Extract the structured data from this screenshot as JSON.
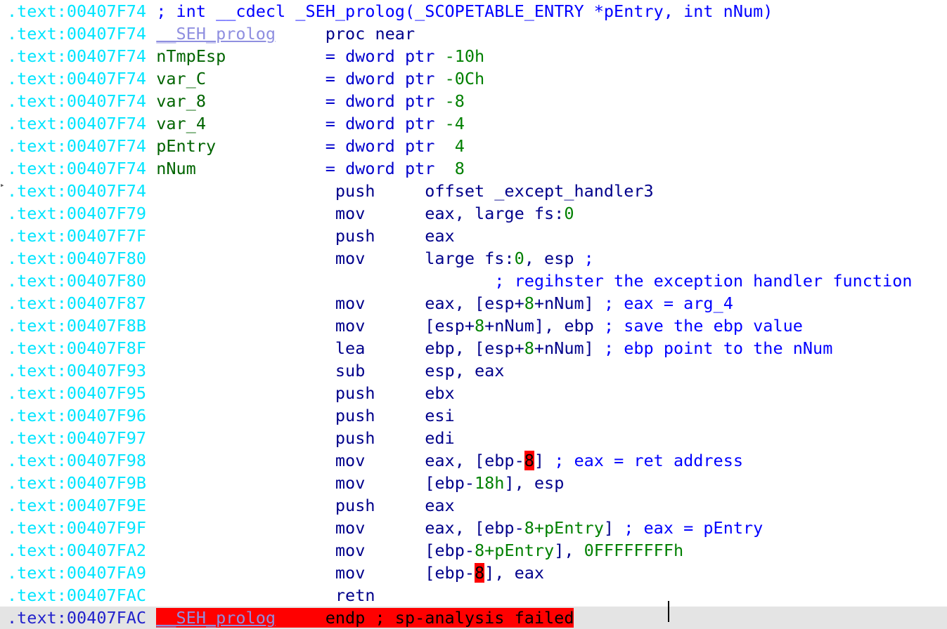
{
  "view": {
    "name": "IDA View-A",
    "segment": "text",
    "caret_visible": true
  },
  "colors": {
    "address": "#00e5ff",
    "address_current": "#2222cc",
    "keyword": "#00008b",
    "directive": "#0000cd",
    "local_var": "#006400",
    "number": "#008000",
    "comment": "#0000ff",
    "function_name": "#8f8fe0",
    "highlight_bg": "#ff0000",
    "highlight_fg": "#000000",
    "current_line_bg": "#e4e4e4",
    "background": "#ffffff"
  },
  "prototype": {
    "address": ".text:00407F74",
    "text": "; int __cdecl _SEH_prolog(_SCOPETABLE_ENTRY *pEntry, int nNum)"
  },
  "proc_header": {
    "address": ".text:00407F74",
    "name": "__SEH_prolog",
    "directive": "proc near"
  },
  "stack_vars": [
    {
      "address": ".text:00407F74",
      "name": "nTmpEsp",
      "eq": "=",
      "type": "dword ptr",
      "offset": "-10h"
    },
    {
      "address": ".text:00407F74",
      "name": "var_C",
      "eq": "=",
      "type": "dword ptr",
      "offset": "-0Ch"
    },
    {
      "address": ".text:00407F74",
      "name": "var_8",
      "eq": "=",
      "type": "dword ptr",
      "offset": "-8"
    },
    {
      "address": ".text:00407F74",
      "name": "var_4",
      "eq": "=",
      "type": "dword ptr",
      "offset": "-4"
    },
    {
      "address": ".text:00407F74",
      "name": "pEntry",
      "eq": "=",
      "type": "dword ptr",
      "offset": " 4"
    },
    {
      "address": ".text:00407F74",
      "name": "nNum",
      "eq": "=",
      "type": "dword ptr",
      "offset": " 8"
    }
  ],
  "instructions": [
    {
      "address": ".text:00407F74",
      "marker": "arrow",
      "mnemonic": "push",
      "op_pre": "offset _except_handler3",
      "op_num": "",
      "op_post": "",
      "comment": ""
    },
    {
      "address": ".text:00407F79",
      "marker": "",
      "mnemonic": "mov",
      "op_pre": "eax, large fs:",
      "op_num": "0",
      "op_post": "",
      "comment": ""
    },
    {
      "address": ".text:00407F7F",
      "marker": "",
      "mnemonic": "push",
      "op_pre": "eax",
      "op_num": "",
      "op_post": "",
      "comment": ""
    },
    {
      "address": ".text:00407F80",
      "marker": "",
      "mnemonic": "mov",
      "op_pre": "large fs:",
      "op_num": "0",
      "op_post": ", esp ",
      "comment": ";"
    },
    {
      "address": ".text:00407F80",
      "marker": "",
      "mnemonic": "",
      "op_pre": "",
      "op_num": "",
      "op_post": "",
      "comment": "; regihster the exception handler function",
      "comment_indent": true
    },
    {
      "address": ".text:00407F87",
      "marker": "",
      "mnemonic": "mov",
      "op_pre": "eax, [esp+",
      "op_num": "8",
      "op_post": "+nNum] ",
      "op_post_var": "nNum",
      "comment": "; eax = arg_4"
    },
    {
      "address": ".text:00407F8B",
      "marker": "",
      "mnemonic": "mov",
      "op_pre": "[esp+",
      "op_num": "8",
      "op_post": "+nNum], ebp ",
      "comment": "; save the ebp value"
    },
    {
      "address": ".text:00407F8F",
      "marker": "",
      "mnemonic": "lea",
      "op_pre": "ebp, [esp+",
      "op_num": "8",
      "op_post": "+nNum] ",
      "comment": "; ebp point to the nNum"
    },
    {
      "address": ".text:00407F93",
      "marker": "",
      "mnemonic": "sub",
      "op_pre": "esp, eax",
      "op_num": "",
      "op_post": "",
      "comment": ""
    },
    {
      "address": ".text:00407F95",
      "marker": "",
      "mnemonic": "push",
      "op_pre": "ebx",
      "op_num": "",
      "op_post": "",
      "comment": ""
    },
    {
      "address": ".text:00407F96",
      "marker": "",
      "mnemonic": "push",
      "op_pre": "esi",
      "op_num": "",
      "op_post": "",
      "comment": ""
    },
    {
      "address": ".text:00407F97",
      "marker": "",
      "mnemonic": "push",
      "op_pre": "edi",
      "op_num": "",
      "op_post": "",
      "comment": ""
    },
    {
      "address": ".text:00407F98",
      "marker": "",
      "mnemonic": "mov",
      "op_pre": "eax, [ebp-",
      "op_num": "8",
      "op_num_highlight": true,
      "op_post": "] ",
      "comment": "; eax = ret address"
    },
    {
      "address": ".text:00407F9B",
      "marker": "",
      "mnemonic": "mov",
      "op_pre": "[ebp-",
      "op_num": "18h",
      "op_post": "], esp",
      "comment": ""
    },
    {
      "address": ".text:00407F9E",
      "marker": "",
      "mnemonic": "push",
      "op_pre": "eax",
      "op_num": "",
      "op_post": "",
      "comment": ""
    },
    {
      "address": ".text:00407F9F",
      "marker": "",
      "mnemonic": "mov",
      "op_pre": "eax, [ebp-",
      "op_num": "8+pEntry",
      "op_post": "] ",
      "comment": "; eax = pEntry"
    },
    {
      "address": ".text:00407FA2",
      "marker": "",
      "mnemonic": "mov",
      "op_pre": "[ebp-",
      "op_num": "8+pEntry",
      "op_post": "], ",
      "op_tail_num": "0FFFFFFFFh",
      "comment": ""
    },
    {
      "address": ".text:00407FA9",
      "marker": "",
      "mnemonic": "mov",
      "op_pre": "[ebp-",
      "op_num": "8",
      "op_num_highlight": true,
      "op_post": "], eax",
      "comment": ""
    },
    {
      "address": ".text:00407FAC",
      "marker": "",
      "mnemonic": "retn",
      "op_pre": "",
      "op_num": "",
      "op_post": "",
      "comment": ""
    }
  ],
  "proc_footer": {
    "address": ".text:00407FAC",
    "name": "__SEH_prolog",
    "directive": "endp ; sp-analysis failed",
    "selected": true
  }
}
